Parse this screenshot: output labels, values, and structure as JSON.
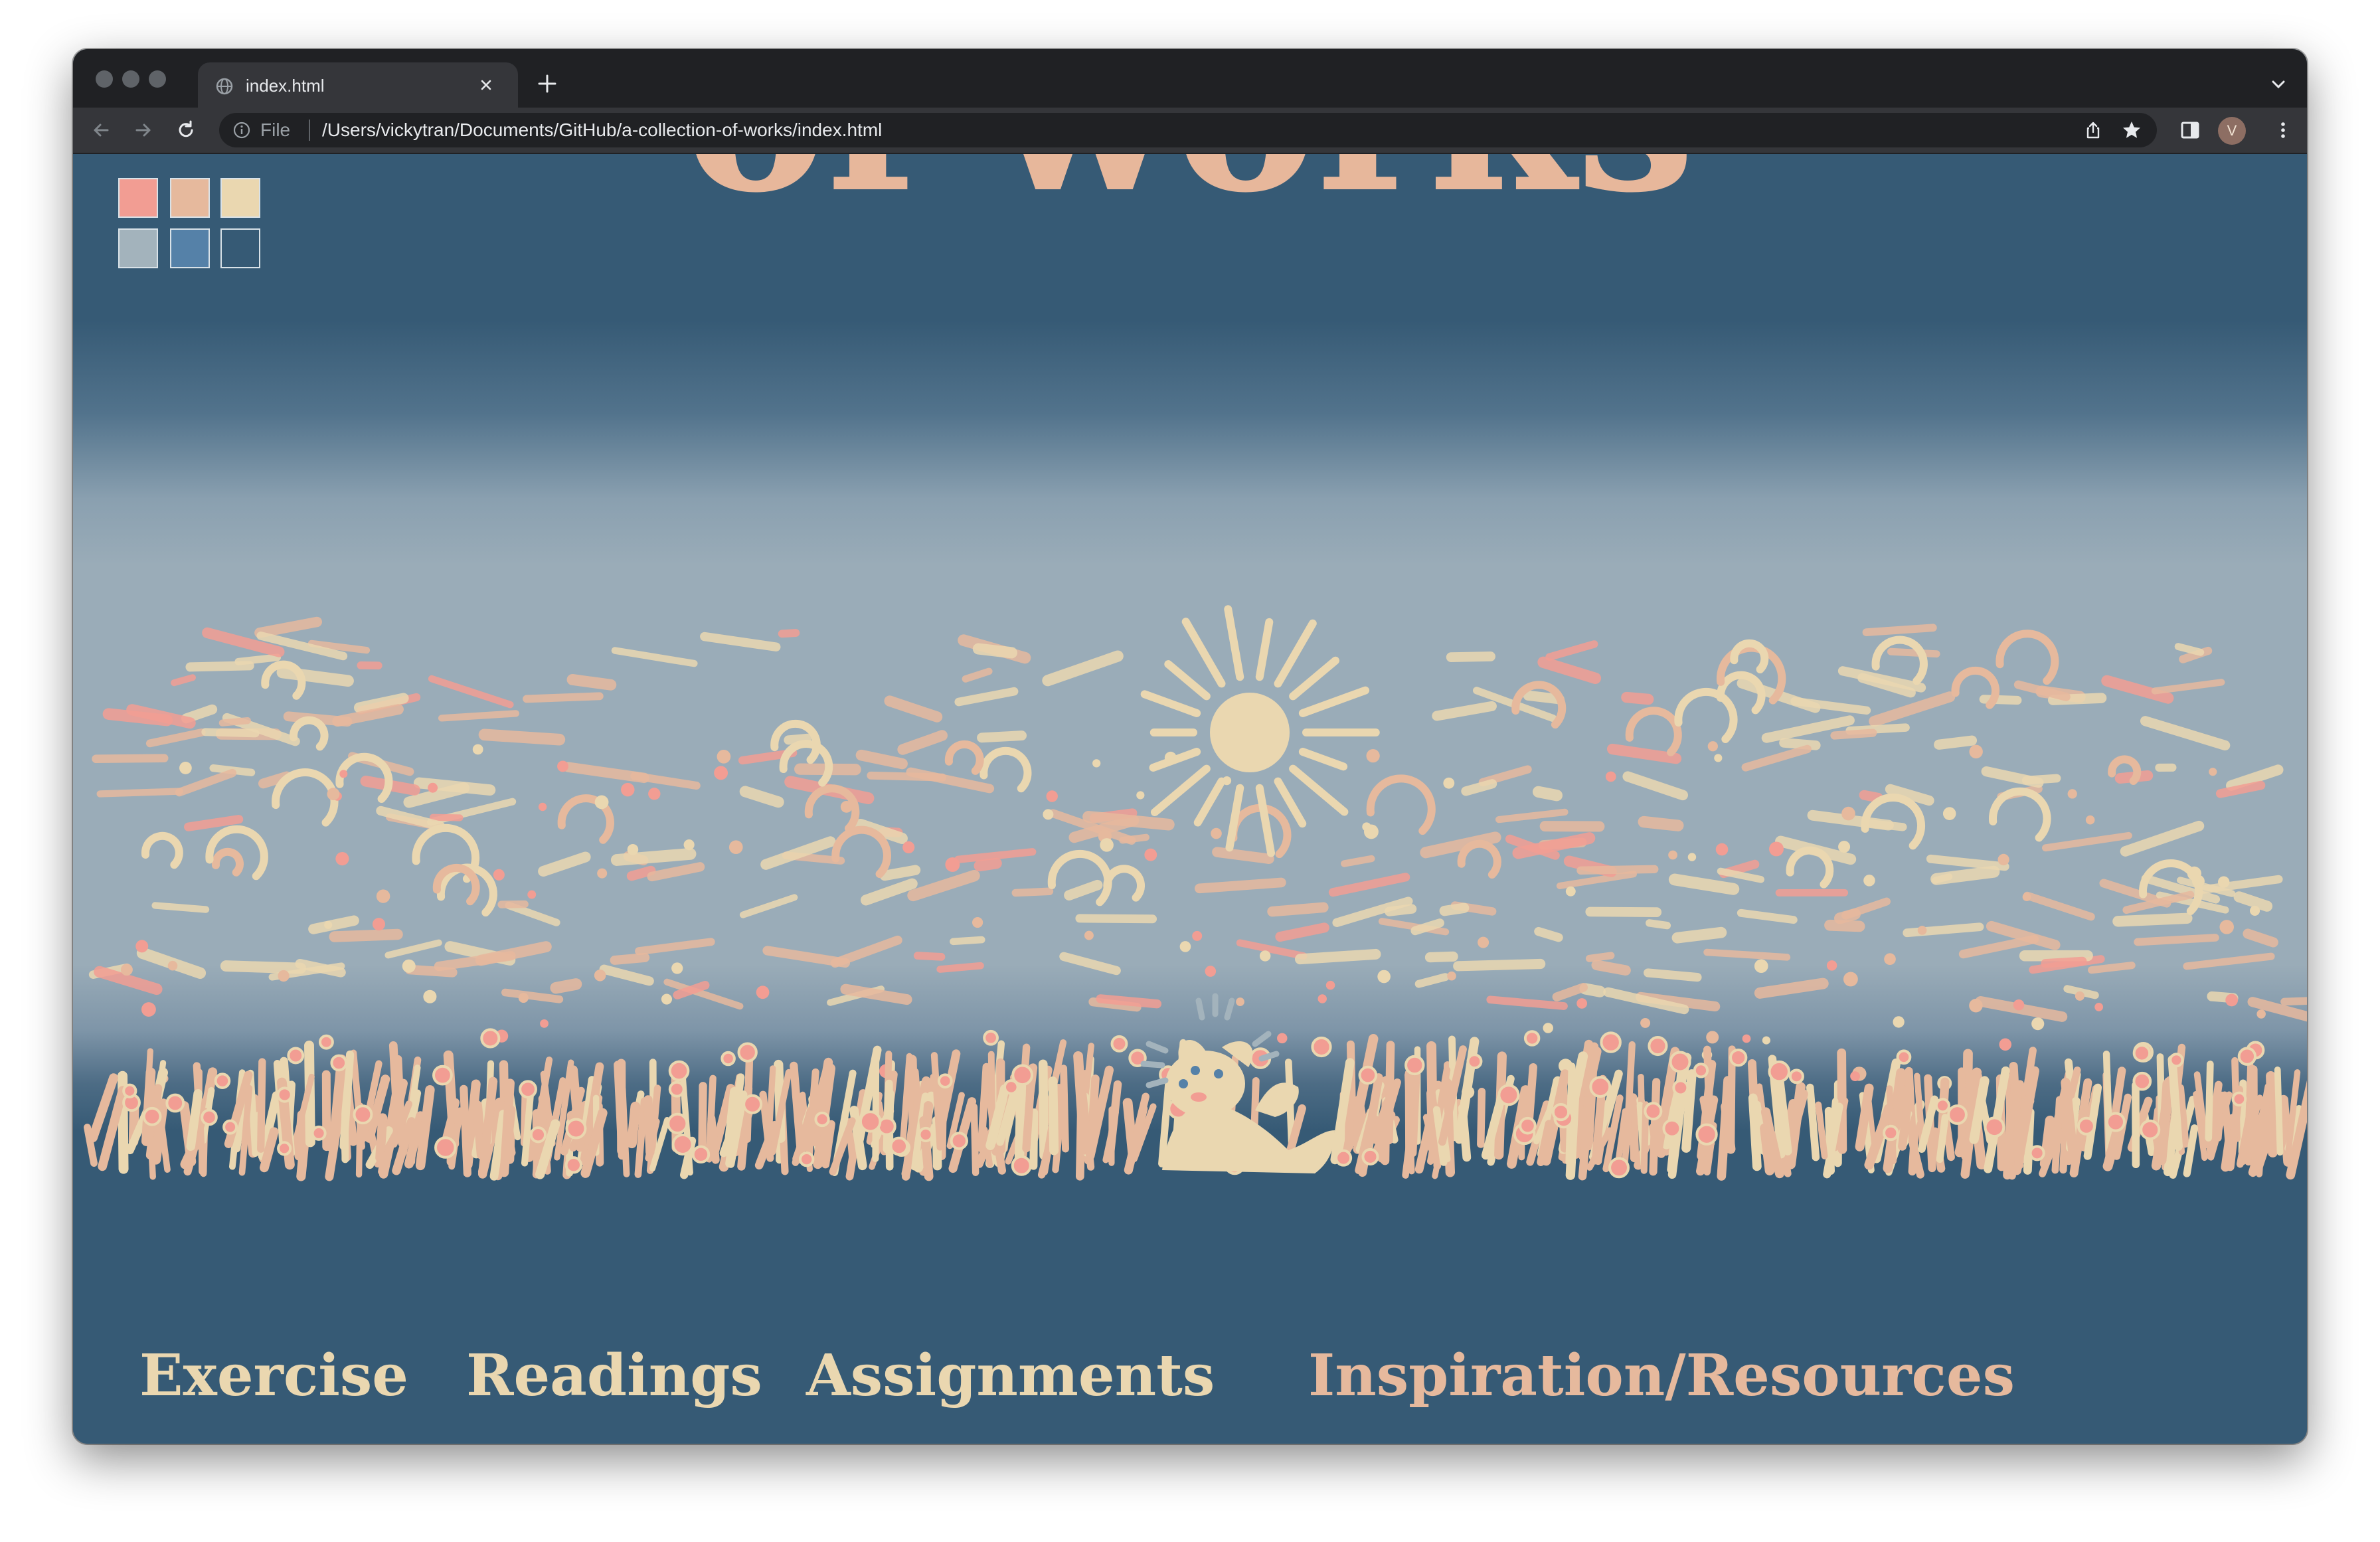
{
  "browser": {
    "tab_title": "index.html",
    "url_scheme": "File",
    "url_path": "/Users/vickytran/Documents/GitHub/a-collection-of-works/index.html",
    "avatar_letter": "V"
  },
  "page": {
    "title_fragment": "of works",
    "swatches": [
      {
        "color": "#f29d93"
      },
      {
        "color": "#e6b99d"
      },
      {
        "color": "#ead7b0"
      },
      {
        "color": "#a3b3bc"
      },
      {
        "color": "#5581a8"
      },
      {
        "color": "#365a75"
      }
    ],
    "nav": {
      "exercise": "Exercise",
      "readings": "Readings",
      "assignments": "Assignments",
      "inspiration": "Inspiration/Resources"
    },
    "colors": {
      "background": "#365a75",
      "cream": "#ead7b0",
      "peach": "#e6b99d",
      "pink": "#f29d93"
    }
  }
}
